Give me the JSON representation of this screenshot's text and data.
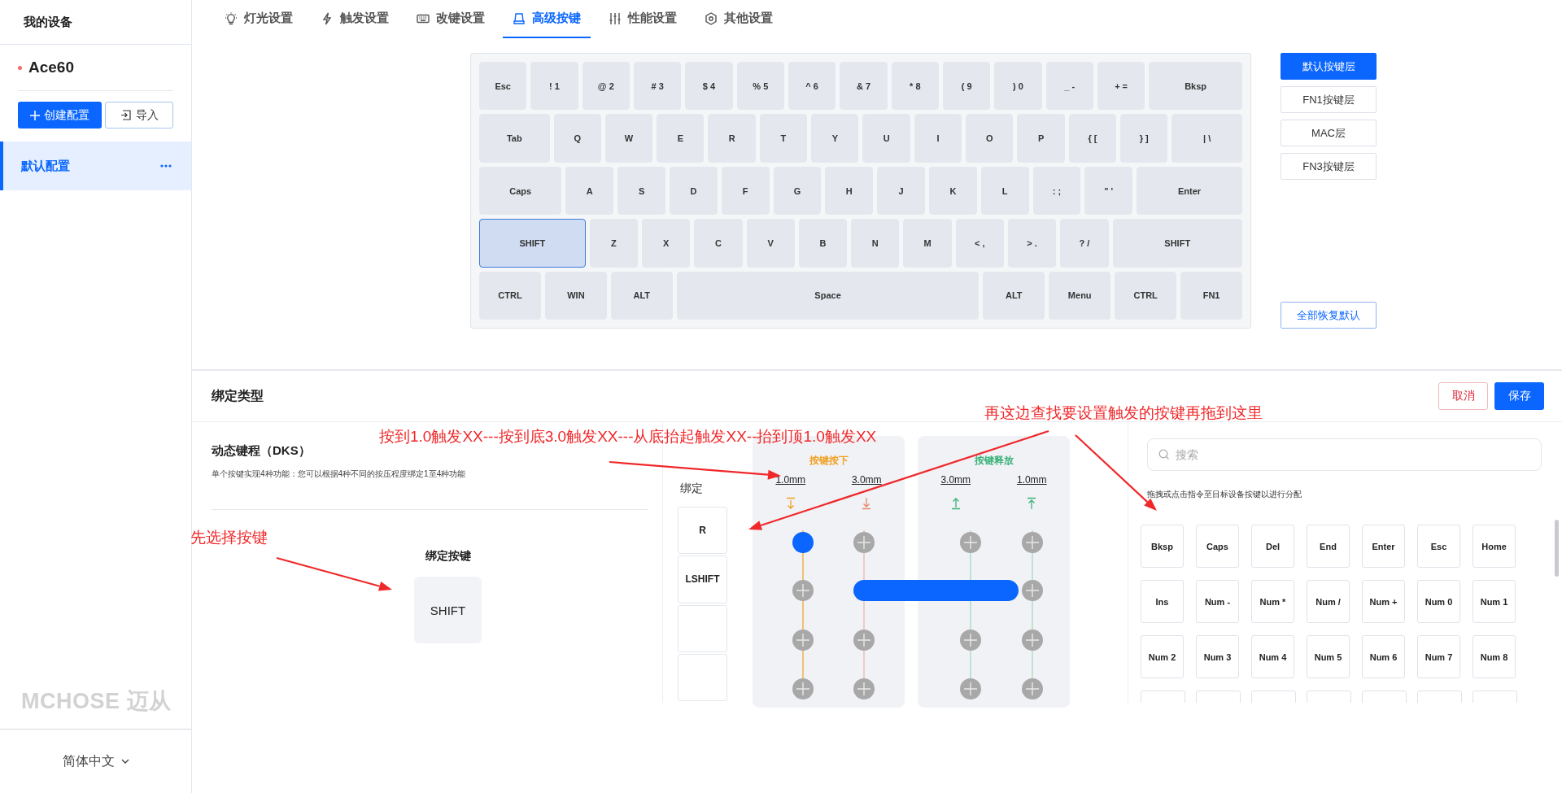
{
  "sidebar": {
    "title": "我的设备",
    "device": {
      "name": "Ace60",
      "color": "#f56c6c"
    },
    "create_button": "创建配置",
    "import_button": "导入",
    "configs": [
      {
        "label": "默认配置",
        "selected": true
      }
    ],
    "logo": "MCHOSE 迈从",
    "language": "简体中文"
  },
  "tabs": [
    {
      "label": "灯光设置",
      "selected": false
    },
    {
      "label": "触发设置",
      "selected": false
    },
    {
      "label": "改键设置",
      "selected": false
    },
    {
      "label": "高级按键",
      "selected": true
    },
    {
      "label": "性能设置",
      "selected": false
    },
    {
      "label": "其他设置",
      "selected": false
    }
  ],
  "keyboard": {
    "rows": [
      [
        {
          "label": "Esc",
          "selected": false
        },
        {
          "label": "! 1",
          "selected": false
        },
        {
          "label": "@ 2",
          "selected": false
        },
        {
          "label": "# 3",
          "selected": false
        },
        {
          "label": "$ 4",
          "selected": false
        },
        {
          "label": "% 5",
          "selected": false
        },
        {
          "label": "^ 6",
          "selected": false
        },
        {
          "label": "& 7",
          "selected": false
        },
        {
          "label": "* 8",
          "selected": false
        },
        {
          "label": "( 9",
          "selected": false
        },
        {
          "label": ") 0",
          "selected": false
        },
        {
          "label": "_ -",
          "selected": false
        },
        {
          "label": "+ =",
          "selected": false
        },
        {
          "label": "Bksp",
          "selected": false
        }
      ],
      [
        {
          "label": "Tab",
          "selected": false
        },
        {
          "label": "Q",
          "selected": false
        },
        {
          "label": "W",
          "selected": false
        },
        {
          "label": "E",
          "selected": false
        },
        {
          "label": "R",
          "selected": false
        },
        {
          "label": "T",
          "selected": false
        },
        {
          "label": "Y",
          "selected": false
        },
        {
          "label": "U",
          "selected": false
        },
        {
          "label": "I",
          "selected": false
        },
        {
          "label": "O",
          "selected": false
        },
        {
          "label": "P",
          "selected": false
        },
        {
          "label": "{ [",
          "selected": false
        },
        {
          "label": "} ]",
          "selected": false
        },
        {
          "label": "| \\",
          "selected": false
        }
      ],
      [
        {
          "label": "Caps",
          "selected": false
        },
        {
          "label": "A",
          "selected": false
        },
        {
          "label": "S",
          "selected": false
        },
        {
          "label": "D",
          "selected": false
        },
        {
          "label": "F",
          "selected": false
        },
        {
          "label": "G",
          "selected": false
        },
        {
          "label": "H",
          "selected": false
        },
        {
          "label": "J",
          "selected": false
        },
        {
          "label": "K",
          "selected": false
        },
        {
          "label": "L",
          "selected": false
        },
        {
          "label": ": ;",
          "selected": false
        },
        {
          "label": "\" '",
          "selected": false
        },
        {
          "label": "Enter",
          "selected": false
        }
      ],
      [
        {
          "label": "SHIFT",
          "selected": true
        },
        {
          "label": "Z",
          "selected": false
        },
        {
          "label": "X",
          "selected": false
        },
        {
          "label": "C",
          "selected": false
        },
        {
          "label": "V",
          "selected": false
        },
        {
          "label": "B",
          "selected": false
        },
        {
          "label": "N",
          "selected": false
        },
        {
          "label": "M",
          "selected": false
        },
        {
          "label": "< ,",
          "selected": false
        },
        {
          "label": "> .",
          "selected": false
        },
        {
          "label": "? /",
          "selected": false
        },
        {
          "label": "SHIFT",
          "selected": false
        }
      ],
      [
        {
          "label": "CTRL",
          "selected": false
        },
        {
          "label": "WIN",
          "selected": false
        },
        {
          "label": "ALT",
          "selected": false
        },
        {
          "label": "Space",
          "selected": false
        },
        {
          "label": "ALT",
          "selected": false
        },
        {
          "label": "Menu",
          "selected": false
        },
        {
          "label": "CTRL",
          "selected": false
        },
        {
          "label": "FN1",
          "selected": false
        }
      ]
    ]
  },
  "layers": [
    {
      "label": "默认按键层",
      "selected": true
    },
    {
      "label": "FN1按键层",
      "selected": false
    },
    {
      "label": "MAC层",
      "selected": false
    },
    {
      "label": "FN3按键层",
      "selected": false
    }
  ],
  "reset_button": "全部恢复默认",
  "binding": {
    "title": "绑定类型",
    "cancel_button": "取消",
    "save_button": "保存",
    "mode_title": "动态键程（DKS）",
    "mode_description": "单个按键实现4种功能：您可以根据4种不同的按压程度绑定1至4种功能",
    "bound_key_label": "绑定按键",
    "bound_key": "SHIFT"
  },
  "dks": {
    "slots_label": "绑定",
    "slots": [
      {
        "label": "R"
      },
      {
        "label": "LSHIFT"
      }
    ],
    "panels": [
      {
        "title": "按键按下",
        "kind": "press",
        "columns": [
          {
            "distance": "1.0mm",
            "kind": "press-start"
          },
          {
            "distance": "3.0mm",
            "kind": "press-end"
          }
        ]
      },
      {
        "title": "按键释放",
        "kind": "release",
        "columns": [
          {
            "distance": "3.0mm",
            "kind": "release-start"
          },
          {
            "distance": "1.0mm",
            "kind": "release-end"
          }
        ]
      }
    ],
    "rows": [
      {
        "cells": [
          {
            "bound": true
          },
          {
            "bound": false
          },
          {
            "bound": false
          },
          {
            "bound": false
          }
        ]
      },
      {
        "cells": [
          {
            "bound": false
          },
          {
            "bound": true
          },
          {
            "bound": true
          },
          {
            "bound": false
          }
        ]
      },
      {
        "cells": [
          {
            "bound": false
          },
          {
            "bound": false
          },
          {
            "bound": false
          },
          {
            "bound": false
          }
        ]
      },
      {
        "cells": [
          {
            "bound": false
          },
          {
            "bound": false
          },
          {
            "bound": false
          },
          {
            "bound": false
          }
        ]
      }
    ]
  },
  "key_library": {
    "search_placeholder": "搜索",
    "hint": "拖拽或点击指令至目标设备按键以进行分配",
    "keys": [
      {
        "label": "Bksp"
      },
      {
        "label": "Caps"
      },
      {
        "label": "Del"
      },
      {
        "label": "End"
      },
      {
        "label": "Enter"
      },
      {
        "label": "Esc"
      },
      {
        "label": "Home"
      },
      {
        "label": "Ins"
      },
      {
        "label": "Num -"
      },
      {
        "label": "Num *"
      },
      {
        "label": "Num /"
      },
      {
        "label": "Num +"
      },
      {
        "label": "Num 0"
      },
      {
        "label": "Num 1"
      },
      {
        "label": "Num 2"
      },
      {
        "label": "Num 3"
      },
      {
        "label": "Num 4"
      },
      {
        "label": "Num 5"
      },
      {
        "label": "Num 6"
      },
      {
        "label": "Num 7"
      },
      {
        "label": "Num 8"
      },
      {
        "kind": "clipped"
      },
      {
        "kind": "clipped"
      },
      {
        "kind": "clipped"
      },
      {
        "kind": "clipped"
      },
      {
        "kind": "clipped"
      },
      {
        "kind": "clipped"
      },
      {
        "kind": "clipped"
      }
    ]
  },
  "annotations": [
    {
      "text": "按到1.0触发XX---按到底3.0触发XX---从底抬起触发XX--抬到顶1.0触发XX"
    },
    {
      "text": "再这边查找要设置触发的按键再拖到这里"
    },
    {
      "text": "先选择按键"
    }
  ]
}
